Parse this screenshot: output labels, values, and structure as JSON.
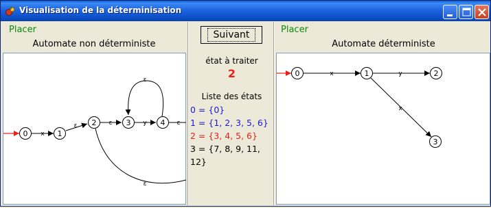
{
  "window": {
    "title": "Visualisation de la déterminisation"
  },
  "icons": {
    "app": "app-icon",
    "minimize": "minimize-icon",
    "maximize": "maximize-icon",
    "close": "close-icon"
  },
  "left_panel": {
    "placer_label": "Placer",
    "heading": "Automate non déterministe",
    "states": [
      "0",
      "1",
      "2",
      "3",
      "4"
    ],
    "edge_labels": [
      "x",
      "ε",
      "ε",
      "y",
      "ε",
      "ε",
      "ε"
    ]
  },
  "middle": {
    "button_label": "Suivant",
    "etat_label": "état à traiter",
    "etat_value": "2",
    "liste_label": "Liste des états",
    "states": [
      {
        "text": "0 = {0}",
        "color": "#1a1ad6"
      },
      {
        "text": "1 = {1, 2, 3, 5, 6}",
        "color": "#1a1ad6"
      },
      {
        "text": "2 = {3, 4, 5, 6}",
        "color": "#e8201b"
      },
      {
        "text": "3 = {7, 8, 9, 11,",
        "color": "#000000"
      },
      {
        "text": "12}",
        "color": "#000000"
      }
    ]
  },
  "right_panel": {
    "placer_label": "Placer",
    "heading": "Automate déterministe",
    "states": [
      "0",
      "1",
      "2",
      "3"
    ],
    "edge_labels": [
      "x",
      "y",
      "x"
    ]
  },
  "colors": {
    "title_bar": "#0b4ec6",
    "placer": "#0a8a0a",
    "initial_arrow": "#e8201b",
    "current_state": "#e8201b",
    "processed_state": "#1a1ad6"
  }
}
